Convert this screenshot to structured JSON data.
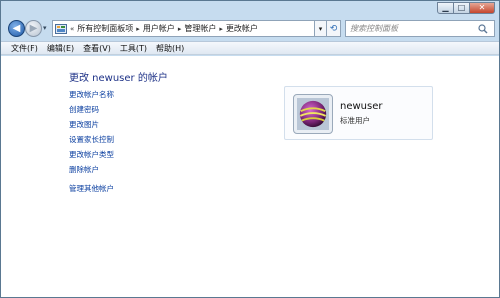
{
  "window": {
    "caption_buttons": [
      "minimize",
      "maximize",
      "close"
    ]
  },
  "address_bar": {
    "overflow": "«",
    "breadcrumbs": [
      "所有控制面板项",
      "用户帐户",
      "管理帐户",
      "更改帐户"
    ],
    "separator": "▸"
  },
  "search": {
    "placeholder": "搜索控制面板"
  },
  "menu": {
    "items": [
      "文件(F)",
      "编辑(E)",
      "查看(V)",
      "工具(T)",
      "帮助(H)"
    ]
  },
  "main": {
    "title": "更改 newuser 的帐户",
    "tasks": [
      "更改帐户名称",
      "创建密码",
      "更改图片",
      "设置家长控制",
      "更改帐户类型",
      "删除帐户"
    ],
    "other": "管理其他帐户"
  },
  "user": {
    "name": "newuser",
    "type": "标准用户"
  },
  "colors": {
    "link": "#0b3fa0",
    "title": "#1e3287",
    "chrome": "#c6dcef"
  }
}
